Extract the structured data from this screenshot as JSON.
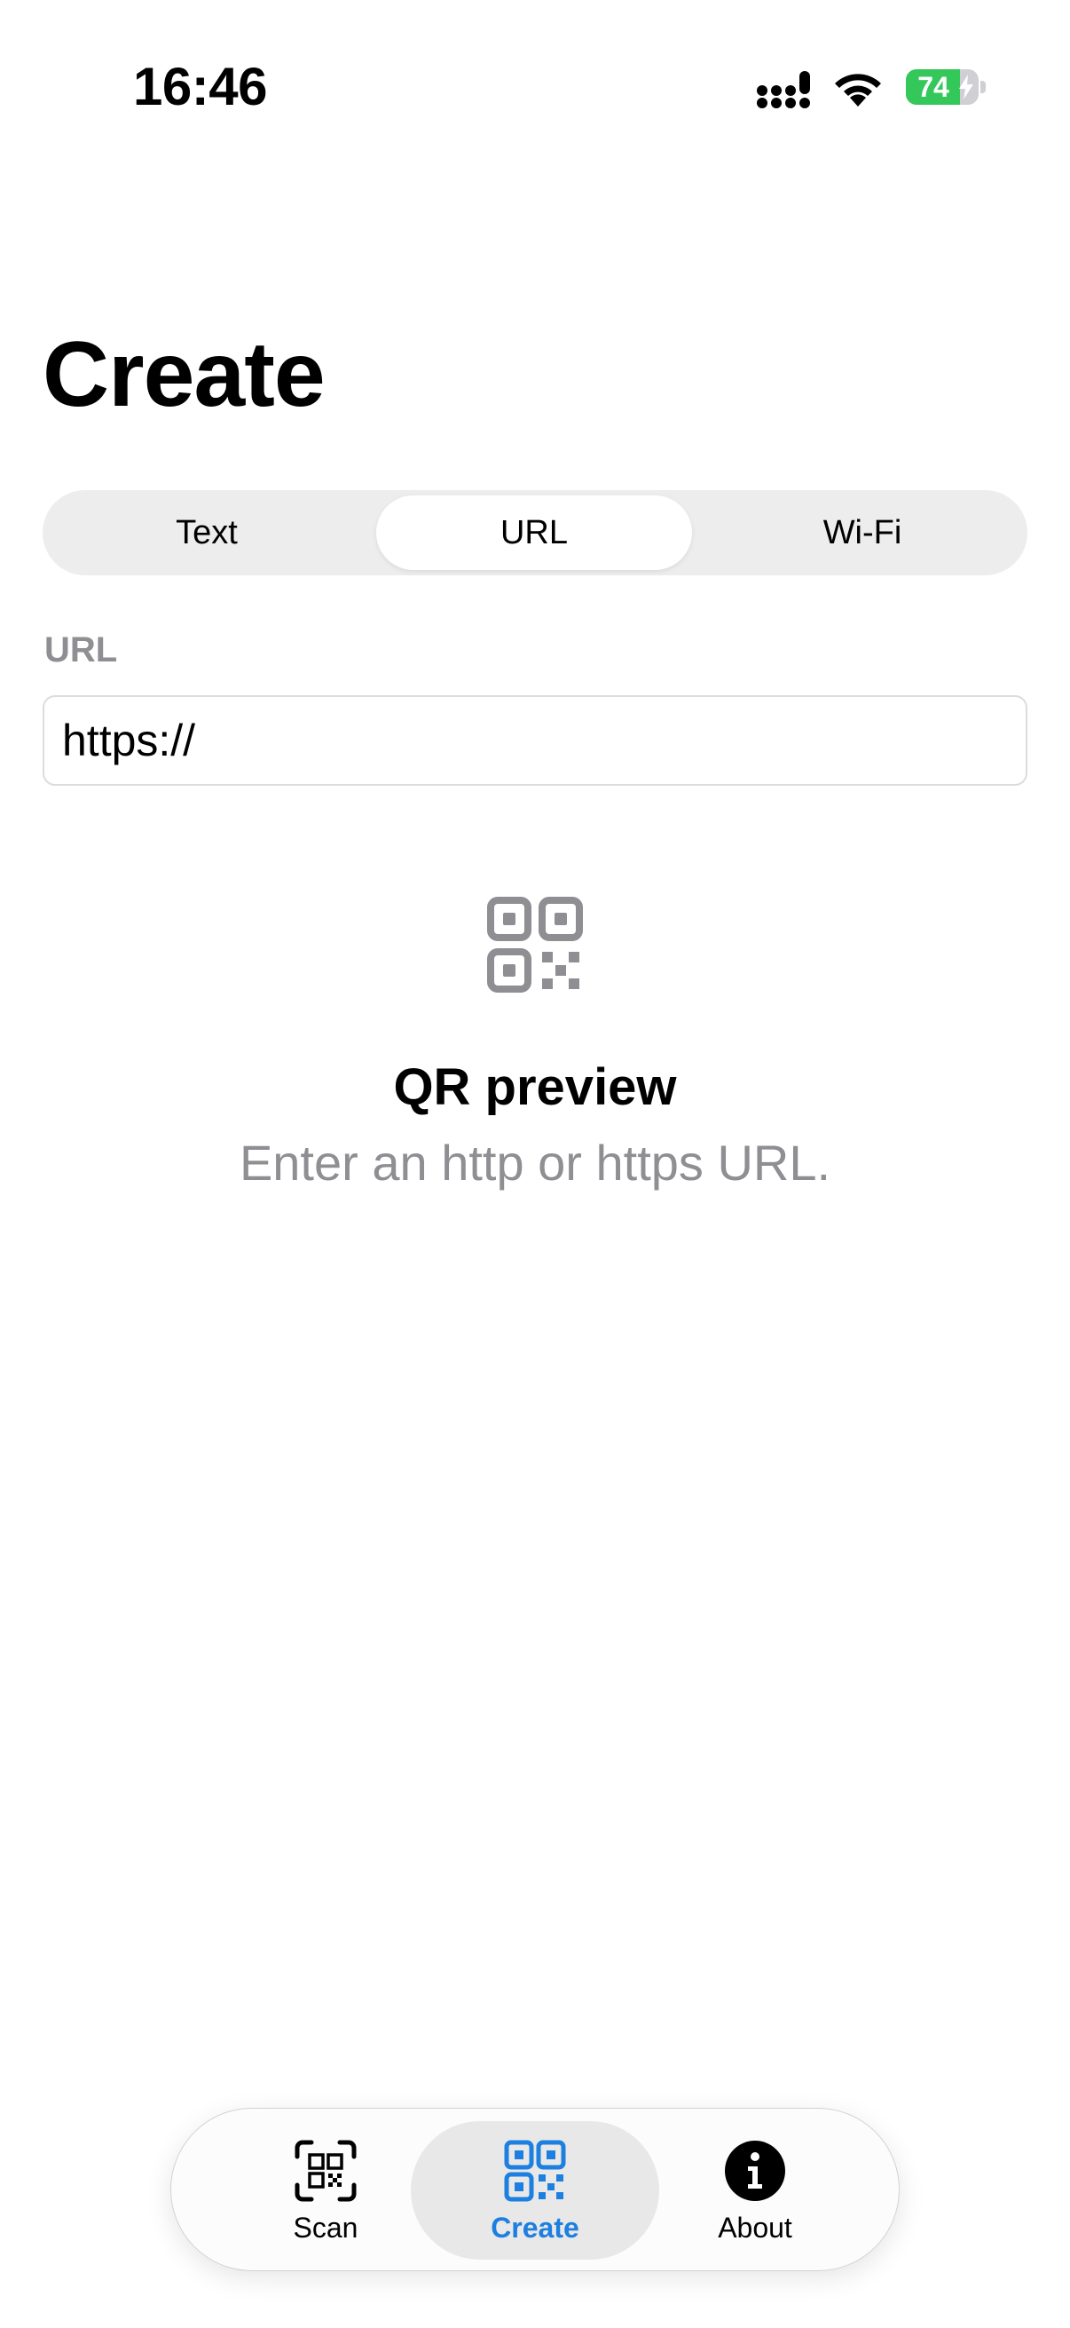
{
  "status_bar": {
    "time": "16:46",
    "battery_level": "74",
    "battery_fraction": 0.74,
    "battery_color": "#34c759",
    "icons": [
      "signal-icon",
      "wifi-icon",
      "battery-icon",
      "charging-bolt-icon"
    ]
  },
  "page": {
    "title": "Create"
  },
  "segmented_control": {
    "segments": [
      {
        "label": "Text",
        "selected": false
      },
      {
        "label": "URL",
        "selected": true
      },
      {
        "label": "Wi-Fi",
        "selected": false
      }
    ]
  },
  "url_field": {
    "label": "URL",
    "value": "https://"
  },
  "preview": {
    "icon": "qr-code-icon",
    "title": "QR preview",
    "subtitle": "Enter an http or https URL."
  },
  "tab_bar": {
    "accent_color": "#1d7fe0",
    "tabs": [
      {
        "label": "Scan",
        "icon": "qr-scan-icon",
        "selected": false
      },
      {
        "label": "Create",
        "icon": "qr-code-icon",
        "selected": true
      },
      {
        "label": "About",
        "icon": "info-icon",
        "selected": false
      }
    ]
  }
}
